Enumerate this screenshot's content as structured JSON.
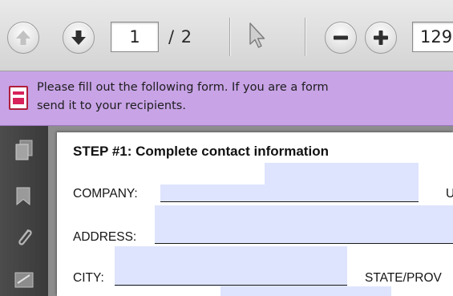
{
  "toolbar": {
    "current_page": "1",
    "page_total": "/ 2",
    "zoom_value": "129"
  },
  "form_bar": {
    "message_line1": "Please fill out the following form. If you are a form",
    "message_line2": "send it to your recipients."
  },
  "document": {
    "step_title": "STEP #1: Complete contact information",
    "labels": {
      "company": "COMPANY:",
      "address": "ADDRESS:",
      "city": "CITY:",
      "state": "STATE/PROV",
      "right_cut": "U"
    }
  },
  "colors": {
    "form_bar_bg": "#c8a3e6",
    "field_fill": "#dee4fd",
    "sidepanel_bg": "#3a3a3a"
  },
  "icons": {
    "toolbar": [
      "arrow-up-icon",
      "arrow-down-icon",
      "cursor-icon",
      "zoom-out-icon",
      "zoom-in-icon"
    ],
    "sidebar": [
      "pages-icon",
      "bookmark-icon",
      "attachment-icon",
      "signature-icon"
    ],
    "form_bar": "form-document-icon"
  }
}
